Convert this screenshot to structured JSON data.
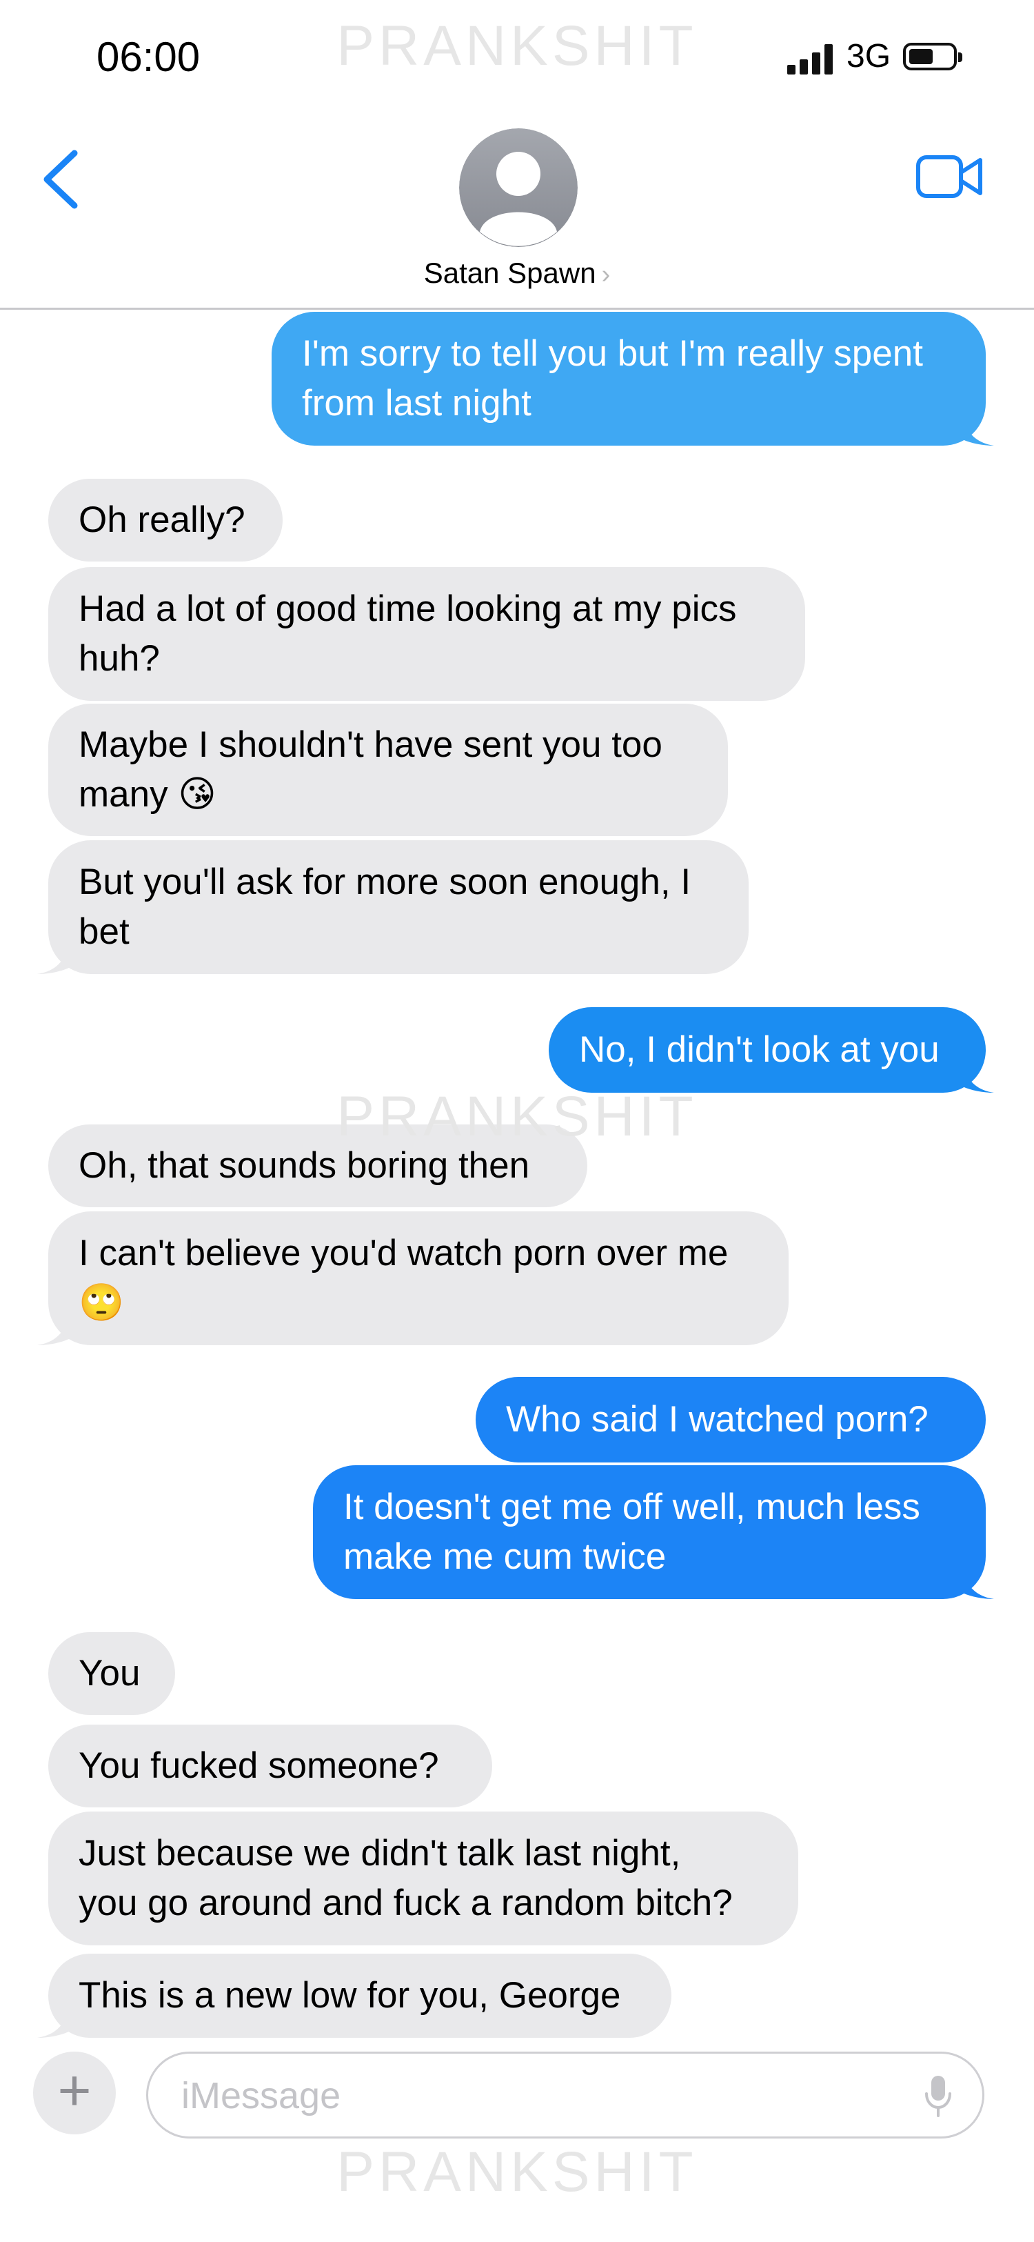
{
  "status_bar": {
    "time": "06:00",
    "network": "3G"
  },
  "watermark": "PRANKSHIT",
  "header": {
    "contact_name": "Satan Spawn",
    "chevron": "›"
  },
  "messages": [
    {
      "side": "out",
      "lines": [
        "I'm sorry to tell you but I'm really spent",
        "from last night"
      ]
    },
    {
      "side": "in",
      "lines": [
        "Oh really?"
      ]
    },
    {
      "side": "in",
      "lines": [
        "Had a lot of good time looking at my pics",
        "huh?"
      ]
    },
    {
      "side": "in",
      "lines": [
        "Maybe I shouldn't have sent you too",
        "many 😘"
      ]
    },
    {
      "side": "in",
      "lines": [
        "But you'll ask for more soon enough, I",
        "bet"
      ]
    },
    {
      "side": "out",
      "lines": [
        "No, I didn't look at you"
      ]
    },
    {
      "side": "in",
      "lines": [
        "Oh, that sounds boring then"
      ]
    },
    {
      "side": "in",
      "lines": [
        "I can't believe you'd watch porn over me",
        "🙄"
      ]
    },
    {
      "side": "out",
      "lines": [
        "Who said I watched porn?"
      ]
    },
    {
      "side": "out",
      "lines": [
        "It doesn't get me off well, much less",
        "make me cum twice"
      ]
    },
    {
      "side": "in",
      "lines": [
        "You"
      ]
    },
    {
      "side": "in",
      "lines": [
        "You fucked someone?"
      ]
    },
    {
      "side": "in",
      "lines": [
        "Just because we didn't talk last night,",
        "you go around and fuck a random bitch?"
      ]
    },
    {
      "side": "in",
      "lines": [
        "This is a new low for you, George"
      ]
    }
  ],
  "composer": {
    "placeholder": "iMessage",
    "value": "",
    "plus_label": "+"
  },
  "icons": [
    "back-chevron-icon",
    "contact-avatar-icon",
    "video-call-icon",
    "plus-icon",
    "microphone-icon"
  ],
  "colors": {
    "incoming": "#e9e9eb",
    "outgoing_light": "#3fa8f3",
    "outgoing": "#1b8df2",
    "ios_blue": "#1a84f6"
  }
}
